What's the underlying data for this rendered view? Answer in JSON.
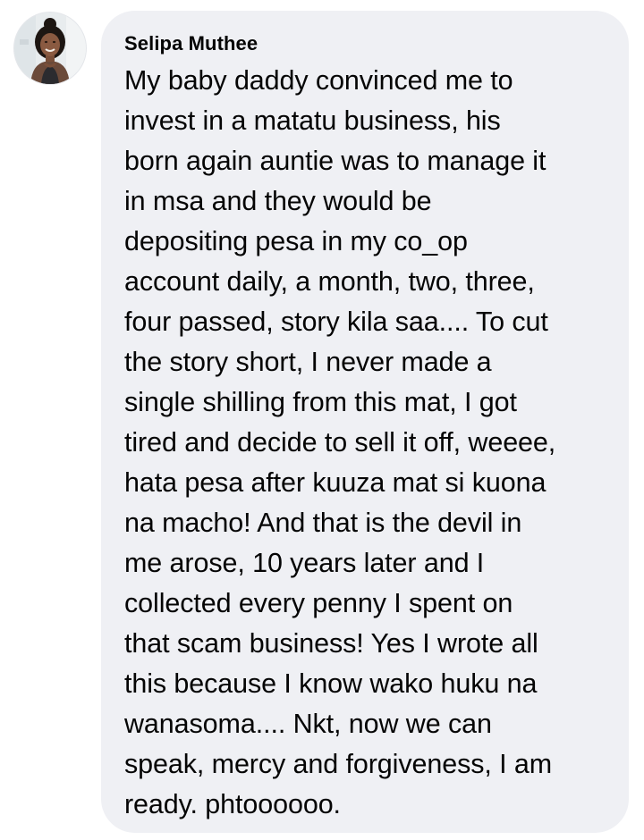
{
  "comment": {
    "author": "Selipa Muthee",
    "avatar_icon": "profile-photo",
    "text": "My baby daddy convinced me to\ninvest in a matatu business, his\nborn again auntie was to manage it\nin msa and they would be\ndepositing pesa in my co_op\naccount daily, a month, two, three,\nfour passed, story kila saa.... To cut\nthe story short, I never made a\nsingle shilling from this mat, I got\ntired and decide to sell it off, weeee,\nhata pesa after kuuza mat si kuona\nna macho! And that is the devil in\nme arose, 10 years later and I\ncollected every penny I spent on\nthat scam business! Yes I wrote all\nthis because I know wako huku na\nwanasoma.... Nkt, now we can\nspeak, mercy and forgiveness, I am\nready. phtoooooo.",
    "bubble_color": "#eff0f4",
    "text_color": "#050505"
  }
}
